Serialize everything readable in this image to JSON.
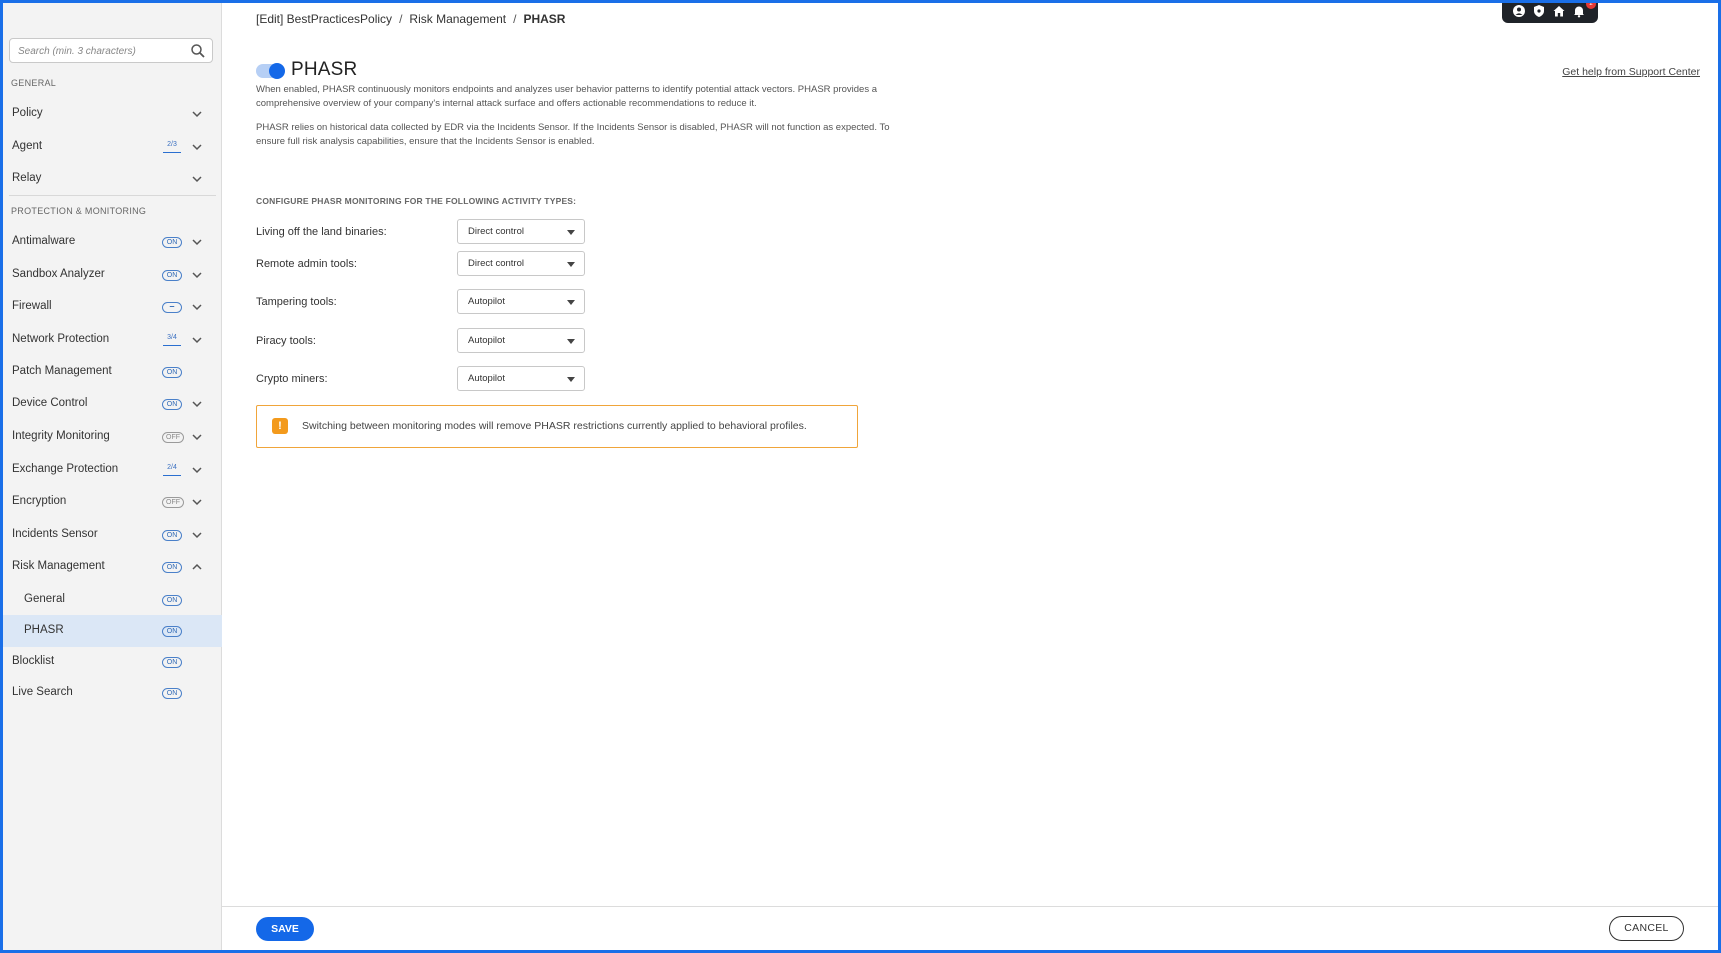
{
  "sidebar": {
    "search_placeholder": "Search (min. 3 characters)",
    "sections": {
      "general": "GENERAL",
      "protection": "PROTECTION & MONITORING"
    },
    "items": {
      "policy": {
        "label": "Policy"
      },
      "agent": {
        "label": "Agent",
        "badge": "2/3"
      },
      "relay": {
        "label": "Relay"
      },
      "antimalware": {
        "label": "Antimalware",
        "badge": "ON"
      },
      "sandbox": {
        "label": "Sandbox Analyzer",
        "badge": "ON"
      },
      "firewall": {
        "label": "Firewall",
        "badge": "–"
      },
      "network": {
        "label": "Network Protection",
        "badge": "3/4"
      },
      "patch": {
        "label": "Patch Management",
        "badge": "ON"
      },
      "device": {
        "label": "Device Control",
        "badge": "ON"
      },
      "integrity": {
        "label": "Integrity Monitoring",
        "badge": "OFF"
      },
      "exchange": {
        "label": "Exchange Protection",
        "badge": "2/4"
      },
      "encryption": {
        "label": "Encryption",
        "badge": "OFF"
      },
      "incidents": {
        "label": "Incidents Sensor",
        "badge": "ON"
      },
      "risk": {
        "label": "Risk Management",
        "badge": "ON"
      },
      "risk_general": {
        "label": "General",
        "badge": "ON"
      },
      "risk_phasr": {
        "label": "PHASR",
        "badge": "ON"
      },
      "blocklist": {
        "label": "Blocklist",
        "badge": "ON"
      },
      "livesearch": {
        "label": "Live Search",
        "badge": "ON"
      }
    }
  },
  "breadcrumb": {
    "item1": "[Edit] BestPracticesPolicy",
    "item2": "Risk Management",
    "current": "PHASR",
    "separator": "/"
  },
  "topbar": {
    "notification_count": "2"
  },
  "header": {
    "title": "PHASR",
    "help_link": "Get help from Support Center",
    "enabled": true
  },
  "description": {
    "p1": "When enabled, PHASR continuously monitors endpoints and analyzes user behavior patterns to identify potential attack vectors. PHASR provides a comprehensive overview of your company's internal attack surface and offers actionable recommendations to reduce it.",
    "p2": "PHASR relies on historical data collected by EDR via the Incidents Sensor. If the Incidents Sensor is disabled, PHASR will not function as expected. To ensure full risk analysis capabilities, ensure that the Incidents Sensor is enabled."
  },
  "config": {
    "title": "CONFIGURE PHASR MONITORING FOR THE FOLLOWING ACTIVITY TYPES:",
    "rows": [
      {
        "label": "Living off the land binaries:",
        "value": "Direct control"
      },
      {
        "label": "Remote admin tools:",
        "value": "Direct control"
      },
      {
        "label": "Tampering tools:",
        "value": "Autopilot"
      },
      {
        "label": "Piracy tools:",
        "value": "Autopilot"
      },
      {
        "label": "Crypto miners:",
        "value": "Autopilot"
      }
    ]
  },
  "warning": {
    "icon": "!",
    "text": "Switching between monitoring modes will remove PHASR restrictions currently applied to behavioral profiles."
  },
  "footer": {
    "save": "SAVE",
    "cancel": "CANCEL"
  },
  "colors": {
    "accent": "#1468e8",
    "warning": "#f39a1c",
    "frame": "#1a6fe8"
  }
}
